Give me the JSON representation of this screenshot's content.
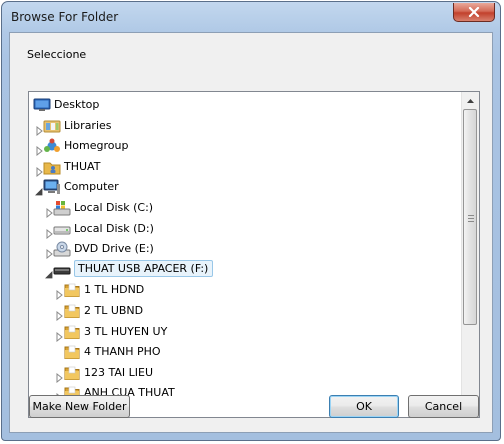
{
  "window": {
    "title": "Browse For Folder"
  },
  "dialog": {
    "prompt": "Seleccione"
  },
  "tree": {
    "items": [
      {
        "label": "Desktop",
        "icon": "desktop-icon",
        "depth": 0,
        "expander": "none"
      },
      {
        "label": "Libraries",
        "icon": "libraries-icon",
        "depth": 1,
        "expander": "collapsed"
      },
      {
        "label": "Homegroup",
        "icon": "homegroup-icon",
        "depth": 1,
        "expander": "collapsed"
      },
      {
        "label": "THUAT",
        "icon": "user-folder-icon",
        "depth": 1,
        "expander": "collapsed"
      },
      {
        "label": "Computer",
        "icon": "computer-icon",
        "depth": 1,
        "expander": "expanded"
      },
      {
        "label": "Local Disk (C:)",
        "icon": "system-drive-icon",
        "depth": 2,
        "expander": "collapsed"
      },
      {
        "label": "Local Disk (D:)",
        "icon": "hard-drive-icon",
        "depth": 2,
        "expander": "collapsed"
      },
      {
        "label": "DVD Drive (E:)",
        "icon": "dvd-drive-icon",
        "depth": 2,
        "expander": "collapsed"
      },
      {
        "label": "THUAT USB APACER (F:)",
        "icon": "usb-drive-icon",
        "depth": 2,
        "expander": "expanded",
        "selected": true
      },
      {
        "label": "1 TL HDND",
        "icon": "folder-icon",
        "depth": 3,
        "expander": "collapsed"
      },
      {
        "label": "2 TL UBND",
        "icon": "folder-icon",
        "depth": 3,
        "expander": "collapsed"
      },
      {
        "label": "3 TL HUYEN UY",
        "icon": "folder-icon",
        "depth": 3,
        "expander": "collapsed"
      },
      {
        "label": "4 THANH PHO",
        "icon": "folder-icon",
        "depth": 3,
        "expander": "none"
      },
      {
        "label": "123 TAI LIEU",
        "icon": "folder-icon",
        "depth": 3,
        "expander": "collapsed"
      },
      {
        "label": "ANH CUA THUAT",
        "icon": "folder-icon",
        "depth": 3,
        "expander": "collapsed"
      }
    ]
  },
  "buttons": {
    "new_folder": "Make New Folder",
    "ok": "OK",
    "cancel": "Cancel"
  },
  "colors": {
    "selection_border": "#99c7e8",
    "selection_fill": "#e8f3fb",
    "folder": "#e8b84a",
    "close": "#c2412c"
  }
}
